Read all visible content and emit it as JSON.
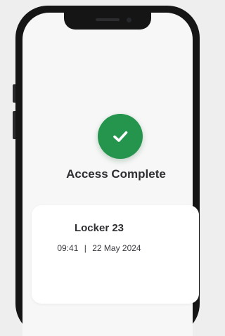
{
  "status": {
    "icon": "checkmark-icon",
    "color": "#25944d",
    "title": "Access Complete"
  },
  "locker": {
    "name": "Locker 23",
    "time": "09:41",
    "separator": "|",
    "date": "22 May 2024"
  }
}
